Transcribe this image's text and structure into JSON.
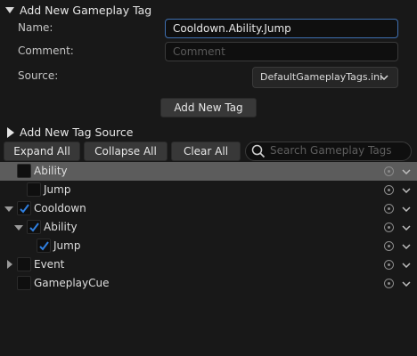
{
  "add_tag_section": {
    "title": "Add New Gameplay Tag",
    "name_label": "Name:",
    "name_value": "Cooldown.Ability.Jump",
    "comment_label": "Comment:",
    "comment_placeholder": "Comment",
    "source_label": "Source:",
    "source_value": "DefaultGameplayTags.ini",
    "add_button_label": "Add New Tag"
  },
  "add_source_section": {
    "title": "Add New Tag Source"
  },
  "toolbar": {
    "expand_all": "Expand All",
    "collapse_all": "Collapse All",
    "clear_all": "Clear All",
    "search_placeholder": "Search Gameplay Tags"
  },
  "tree": [
    {
      "label": "Ability",
      "checked": false,
      "selected": true,
      "expander": "none",
      "depth": 0
    },
    {
      "label": "Jump",
      "checked": false,
      "selected": false,
      "expander": "none",
      "depth": 1
    },
    {
      "label": "Cooldown",
      "checked": true,
      "selected": false,
      "expander": "expanded",
      "depth": 0
    },
    {
      "label": "Ability",
      "checked": true,
      "selected": false,
      "expander": "expanded",
      "depth": 1
    },
    {
      "label": "Jump",
      "checked": true,
      "selected": false,
      "expander": "none",
      "depth": 2
    },
    {
      "label": "Event",
      "checked": false,
      "selected": false,
      "expander": "collapsed",
      "depth": 0
    },
    {
      "label": "GameplayCue",
      "checked": false,
      "selected": false,
      "expander": "none",
      "depth": 0
    }
  ],
  "colors": {
    "background": "#181818",
    "selected_row": "#5c5c5c",
    "checkmark": "#2f7fe0",
    "focus_border": "#3f6fb0"
  },
  "icons": {
    "section_expanded": "chevron-down-icon",
    "section_collapsed": "chevron-right-icon",
    "search": "search-icon",
    "row_action": "circle-dot-icon",
    "row_menu": "chevron-down-icon"
  }
}
